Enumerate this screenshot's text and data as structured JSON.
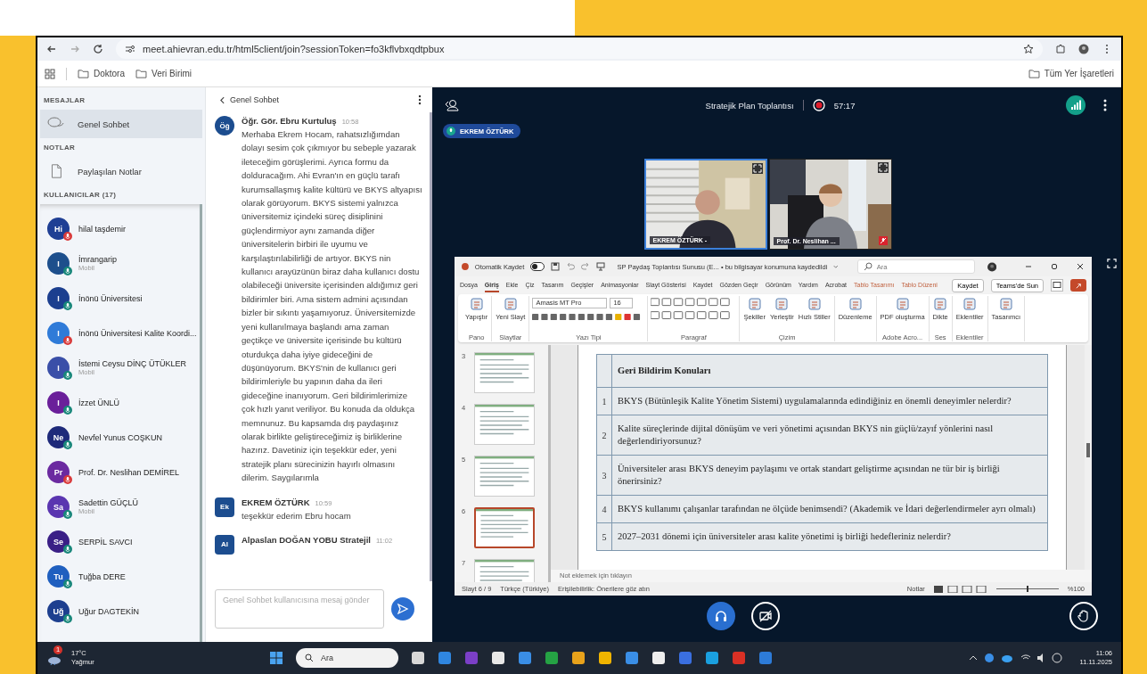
{
  "browser": {
    "url": "meet.ahievran.edu.tr/html5client/join?sessionToken=fo3kflvbxqdtpbux",
    "bookmarks": [
      {
        "label": "Doktora"
      },
      {
        "label": "Veri Birimi"
      }
    ],
    "all_bookmarks": "Tüm Yer İşaretleri"
  },
  "sidebar": {
    "messages_heading": "MESAJLAR",
    "chats": [
      {
        "label": "Genel Sohbet",
        "selected": true
      }
    ],
    "notes_heading": "NOTLAR",
    "notes": [
      {
        "label": "Paylaşılan Notlar",
        "selected": false
      }
    ],
    "users_heading": "KULLANICILAR (17)",
    "users": [
      {
        "initials": "Hi",
        "name": "hilal taşdemir",
        "color": "#1f3f94",
        "muted": true
      },
      {
        "initials": "I",
        "name": "İmrangarip",
        "device": "Mobil",
        "color": "#1d4f8c",
        "muted": false
      },
      {
        "initials": "I",
        "name": "İnönü Üniversitesi",
        "color": "#1c3f8f",
        "muted": false
      },
      {
        "initials": "I",
        "name": "İnönü Üniversitesi Kalite Koordi...",
        "color": "#2f7bd8",
        "muted": true
      },
      {
        "initials": "I",
        "name": "İstemi Ceysu DİNÇ ÜTÜKLER",
        "device": "Mobil",
        "color": "#3a4fa8",
        "muted": false
      },
      {
        "initials": "I",
        "name": "İzzet ÜNLÜ",
        "color": "#6a1f9a",
        "muted": false
      },
      {
        "initials": "Ne",
        "name": "Nevfel Yunus COŞKUN",
        "color": "#1e2a7a",
        "muted": false
      },
      {
        "initials": "Pr",
        "name": "Prof. Dr. Neslihan DEMİREL",
        "color": "#6b2aa0",
        "muted": true
      },
      {
        "initials": "Sa",
        "name": "Sadettin GÜÇLÜ",
        "device": "Mobil",
        "color": "#5a35b0",
        "muted": false
      },
      {
        "initials": "Se",
        "name": "SERPİL SAVCI",
        "color": "#3a1f86",
        "muted": false
      },
      {
        "initials": "Tu",
        "name": "Tuğba DERE",
        "color": "#1f5fbf",
        "muted": false
      },
      {
        "initials": "Uğ",
        "name": "Uğur DAGTEKİN",
        "color": "#1d3f8f",
        "muted": false
      }
    ]
  },
  "chat": {
    "title": "Genel Sohbet",
    "messages": [
      {
        "initials": "Öğ",
        "sender": "Öğr. Gör. Ebru Kurtuluş",
        "time": "10:58",
        "text": "Merhaba Ekrem Hocam, rahatsızlığımdan dolayı sesim çok çıkmıyor bu sebeple yazarak ileteceğim görüşlerimi. Ayrıca formu da dolduracağım. Ahi Evran'ın en güçlü tarafı kurumsallaşmış kalite kültürü ve BKYS altyapısı olarak görüyorum. BKYS sistemi yalnızca üniversitemiz içindeki süreç disiplinini güçlendirmiyor aynı zamanda diğer üniversitelerin birbiri ile uyumu ve karşılaştırılabilirliği de artıyor. BKYS nin kullanıcı arayüzünün biraz daha kullanıcı dostu olabileceği üniversite içerisinden aldığımız geri bildirimler biri. Ama sistem admini açısından bizler bir sıkıntı yaşamıyoruz. Üniversitemizde yeni kullanılmaya başlandı ama zaman geçtikçe ve üniversite içerisinde bu kültürü oturdukça daha iyiye gideceğini de düşünüyorum. BKYS'nin de kullanıcı geri bildirimleriyle bu yapının daha da ileri gideceğine inanıyorum. Geri bildirimlerimize çok hızlı yanıt veriliyor. Bu konuda da oldukça memnunuz. Bu kapsamda dış paydaşınız olarak birlikte geliştireceğimiz iş birliklerine hazırız. Davetiniz için teşekkür eder, yeni stratejik planı sürecinizin hayırlı olmasını dilerim. Saygılarımla"
      },
      {
        "initials": "Ek",
        "sender": "EKREM ÖZTÜRK",
        "time": "10:59",
        "text": "teşekkür ederim Ebru hocam"
      },
      {
        "initials": "Al",
        "sender": "Alpaslan DOĞAN YOBU Stratejil",
        "time": "11:02"
      }
    ],
    "placeholder": "Genel Sohbet kullanıcısına mesaj gönder"
  },
  "meeting": {
    "title": "Stratejik Plan Toplantısı",
    "recording": true,
    "timer": "57:17",
    "talking": "EKREM ÖZTÜRK",
    "videos": [
      {
        "name": "EKREM ÖZTÜRK -",
        "speaking": true,
        "muted": false
      },
      {
        "name": "Prof. Dr. Neslihan ...",
        "speaking": false,
        "muted": true
      }
    ],
    "controls": [
      {
        "kind": "audio",
        "active": true
      },
      {
        "kind": "video",
        "active": false
      },
      {
        "kind": "hand",
        "active": false
      }
    ]
  },
  "powerpoint": {
    "autosave": "Otomatik Kaydet",
    "autosave_on": false,
    "title": "SP Paydaş Toplantısı Sunusu (E... • bu bilgisayar konumuna kaydedildi",
    "search": "Ara",
    "tabs": [
      {
        "label": "Dosya",
        "selected": false,
        "contextual": false
      },
      {
        "label": "Giriş",
        "selected": true,
        "contextual": false
      },
      {
        "label": "Ekle",
        "selected": false,
        "contextual": false
      },
      {
        "label": "Çiz",
        "selected": false,
        "contextual": false
      },
      {
        "label": "Tasarım",
        "selected": false,
        "contextual": false
      },
      {
        "label": "Geçişler",
        "selected": false,
        "contextual": false
      },
      {
        "label": "Animasyonlar",
        "selected": false,
        "contextual": false
      },
      {
        "label": "Slayt Gösterisi",
        "selected": false,
        "contextual": false
      },
      {
        "label": "Kaydet",
        "selected": false,
        "contextual": false
      },
      {
        "label": "Gözden Geçir",
        "selected": false,
        "contextual": false
      },
      {
        "label": "Görünüm",
        "selected": false,
        "contextual": false
      },
      {
        "label": "Yardım",
        "selected": false,
        "contextual": false
      },
      {
        "label": "Acrobat",
        "selected": false,
        "contextual": false
      },
      {
        "label": "Tablo Tasarımı",
        "selected": false,
        "contextual": true
      },
      {
        "label": "Tablo Düzeni",
        "selected": false,
        "contextual": true
      }
    ],
    "actions": [
      "Kaydet",
      "Teams'de Sun"
    ],
    "ribbon": [
      {
        "kind": "buttons",
        "label": "Pano",
        "buttons": [
          "Yapıştır"
        ]
      },
      {
        "kind": "buttons",
        "label": "Slaytlar",
        "buttons": [
          "Yeni Slayt"
        ]
      },
      {
        "kind": "font",
        "label": "Yazı Tipi",
        "font": "Amasis MT Pro",
        "size": "16"
      },
      {
        "kind": "paragraph",
        "label": "Paragraf"
      },
      {
        "kind": "buttons",
        "label": "Çizim",
        "buttons": [
          "Şekiller",
          "Yerleştir",
          "Hızlı Stiller"
        ]
      },
      {
        "kind": "buttons",
        "buttons": [
          "Düzenleme"
        ]
      },
      {
        "kind": "buttons",
        "label": "Adobe Acro...",
        "buttons": [
          "PDF oluşturma"
        ]
      },
      {
        "kind": "buttons",
        "label": "Ses",
        "buttons": [
          "Dikte"
        ]
      },
      {
        "kind": "buttons",
        "label": "Eklentiler",
        "buttons": [
          "Eklentiler"
        ]
      },
      {
        "kind": "buttons",
        "buttons": [
          "Tasarımcı"
        ]
      }
    ],
    "thumbnails": [
      {
        "number": "3",
        "selected": false
      },
      {
        "number": "4",
        "selected": false
      },
      {
        "number": "5",
        "selected": false
      },
      {
        "number": "6",
        "selected": true
      },
      {
        "number": "7",
        "selected": false
      }
    ],
    "table": {
      "heading": "Geri Bildirim Konuları",
      "rows": [
        {
          "number": "1",
          "text": "BKYS (Bütünleşik Kalite Yönetim Sistemi) uygulamalarında edindiğiniz en önemli deneyimler nelerdir?"
        },
        {
          "number": "2",
          "text": "Kalite süreçlerinde dijital dönüşüm ve veri yönetimi açısından BKYS nin güçlü/zayıf yönlerini nasıl değerlendiriyorsunuz?"
        },
        {
          "number": "3",
          "text": "Üniversiteler arası BKYS deneyim paylaşımı ve ortak standart geliştirme açısından ne tür bir iş birliği önerirsiniz?"
        },
        {
          "number": "4",
          "text": "BKYS kullanımı çalışanlar tarafından ne ölçüde benimsendi? (Akademik ve İdari değerlendirmeler ayrı olmalı)"
        },
        {
          "number": "5",
          "text": "2027–2031 dönemi için üniversiteler arası kalite yönetimi iş birliği hedefleriniz nelerdir?"
        }
      ]
    },
    "notes_placeholder": "Not eklemek için tıklayın",
    "status": {
      "slide": "Slayt 6 / 9",
      "language": "Türkçe (Türkiye)",
      "accessibility": "Erişilebilirlik: Önerilere göz atın",
      "notes": "Notlar",
      "zoom": "%100",
      "zoom_slider": {
        "level": 0.5
      }
    }
  },
  "taskbar": {
    "weather_badge": "1",
    "temperature": "17°C",
    "weather": "Yağmur",
    "search": "Ara",
    "time": "11:06",
    "date": "11.11.2025"
  }
}
